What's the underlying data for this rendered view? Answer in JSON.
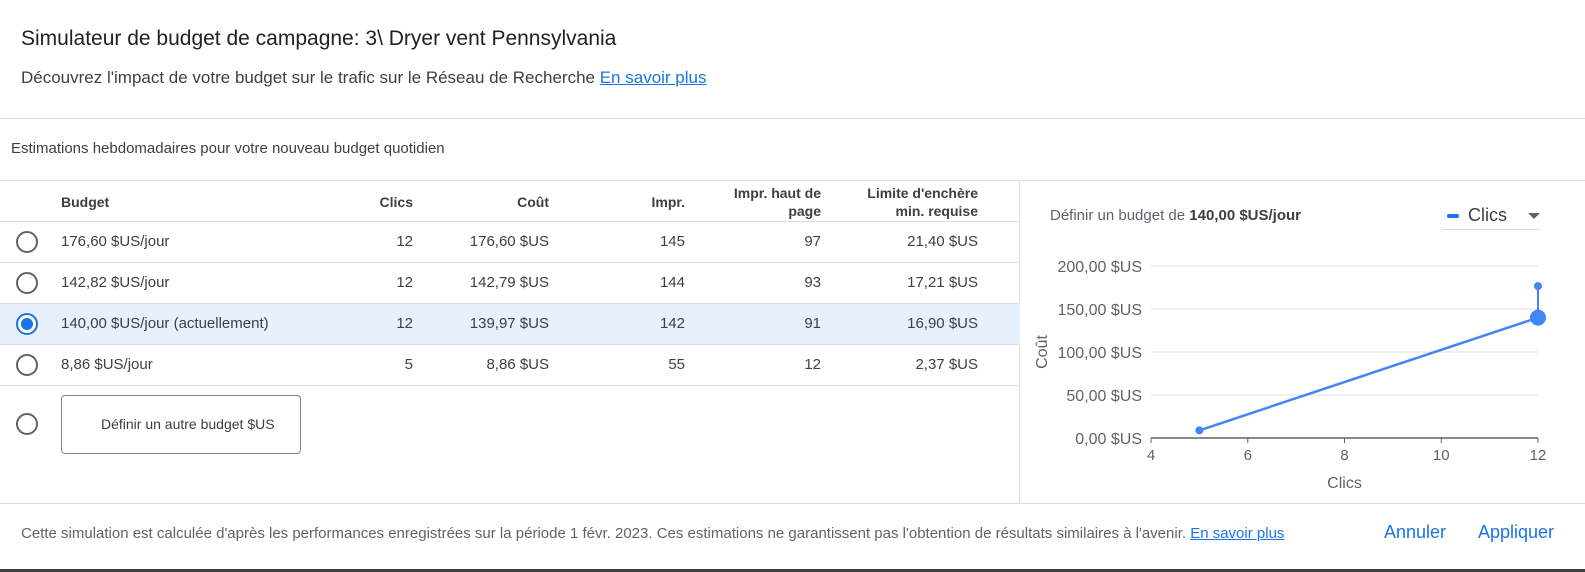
{
  "header": {
    "title": "Simulateur de budget de campagne: 3\\ Dryer vent Pennsylvania",
    "subtitle": "Découvrez l'impact de votre budget sur le trafic sur le Réseau de Recherche",
    "learn_more": "En savoir plus"
  },
  "section_title": "Estimations hebdomadaires pour votre nouveau budget quotidien",
  "table": {
    "headers": {
      "budget": "Budget",
      "clicks": "Clics",
      "cost": "Coût",
      "impr": "Impr.",
      "top_impr_1": "Impr. haut de",
      "top_impr_2": "page",
      "bid_1": "Limite d'enchère",
      "bid_2": "min. requise"
    },
    "rows": [
      {
        "budget": "176,60 $US/jour",
        "clicks": "12",
        "cost": "176,60 $US",
        "impr": "145",
        "top": "97",
        "bid": "21,40 $US",
        "selected": false
      },
      {
        "budget": "142,82 $US/jour",
        "clicks": "12",
        "cost": "142,79 $US",
        "impr": "144",
        "top": "93",
        "bid": "17,21 $US",
        "selected": false
      },
      {
        "budget": "140,00 $US/jour (actuellement)",
        "clicks": "12",
        "cost": "139,97 $US",
        "impr": "142",
        "top": "91",
        "bid": "16,90 $US",
        "selected": true
      },
      {
        "budget": "8,86 $US/jour",
        "clicks": "5",
        "cost": "8,86 $US",
        "impr": "55",
        "top": "12",
        "bid": "2,37 $US",
        "selected": false
      }
    ],
    "custom_budget_label": "Définir un autre budget $US"
  },
  "chart_panel": {
    "heading_prefix": "Définir un budget de",
    "heading_value": "140,00 $US/jour",
    "dropdown_label": "Clics",
    "accent_color": "#1a73e8"
  },
  "chart_data": {
    "type": "line",
    "xlabel": "Clics",
    "ylabel": "Coût",
    "xlim": [
      4,
      12
    ],
    "ylim": [
      0,
      200
    ],
    "x_ticks": [
      "4",
      "6",
      "8",
      "10",
      "12"
    ],
    "y_ticks": [
      "0,00 $US",
      "50,00 $US",
      "100,00 $US",
      "150,00 $US",
      "200,00 $US"
    ],
    "grid": true,
    "series": [
      {
        "name": "Clics",
        "points": [
          {
            "x": 5,
            "y": 8.86
          },
          {
            "x": 12,
            "y": 139.97
          }
        ],
        "color": "#4285f4"
      }
    ],
    "selected_point": {
      "x": 12,
      "y": 139.97
    },
    "extra_point": {
      "x": 12,
      "y": 176.6
    }
  },
  "footer": {
    "note": "Cette simulation est calculée d'après les performances enregistrées sur la période 1 févr. 2023. Ces estimations ne garantissent pas l'obtention de résultats similaires à l'avenir.",
    "learn_more": "En savoir plus",
    "cancel": "Annuler",
    "apply": "Appliquer"
  }
}
